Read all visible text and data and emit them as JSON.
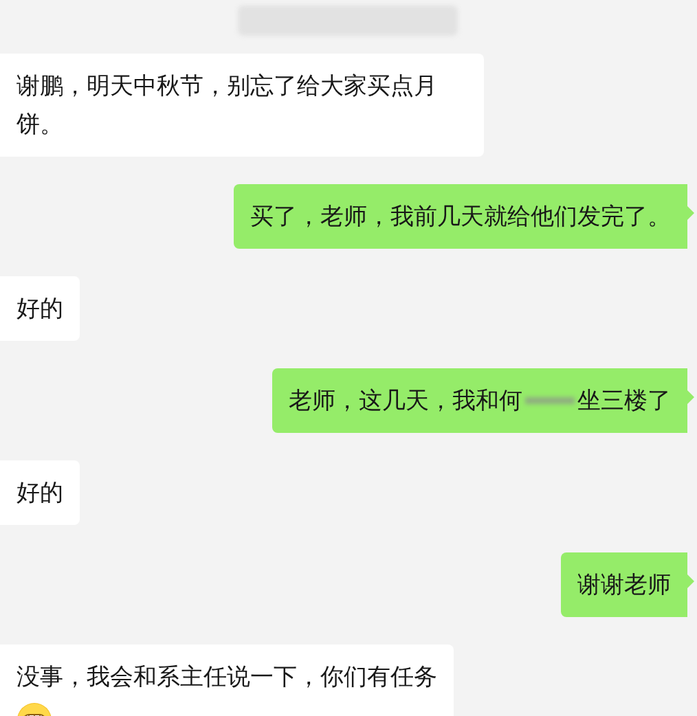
{
  "timestamp": {
    "kind": "blurred"
  },
  "messages": [
    {
      "kind": "received",
      "parts": [
        {
          "kind": "text",
          "text": "谢鹏，明天中秋节，别忘了给大家买点月饼。"
        }
      ]
    },
    {
      "kind": "sent",
      "parts": [
        {
          "kind": "text",
          "text": "买了，老师，我前几天就给他们发完了。"
        }
      ]
    },
    {
      "kind": "received",
      "parts": [
        {
          "kind": "text",
          "text": "好的"
        }
      ]
    },
    {
      "kind": "sent",
      "parts": [
        {
          "kind": "text",
          "text": "老师，这几天，我和何"
        },
        {
          "kind": "redacted"
        },
        {
          "kind": "text",
          "text": "坐三楼了"
        }
      ]
    },
    {
      "kind": "received",
      "parts": [
        {
          "kind": "text",
          "text": "好的"
        }
      ]
    },
    {
      "kind": "sent",
      "parts": [
        {
          "kind": "text",
          "text": "谢谢老师"
        }
      ]
    },
    {
      "kind": "received",
      "parts": [
        {
          "kind": "text",
          "text": "没事，我会和系主任说一下，你们有任务"
        },
        {
          "kind": "emoji"
        }
      ]
    }
  ]
}
